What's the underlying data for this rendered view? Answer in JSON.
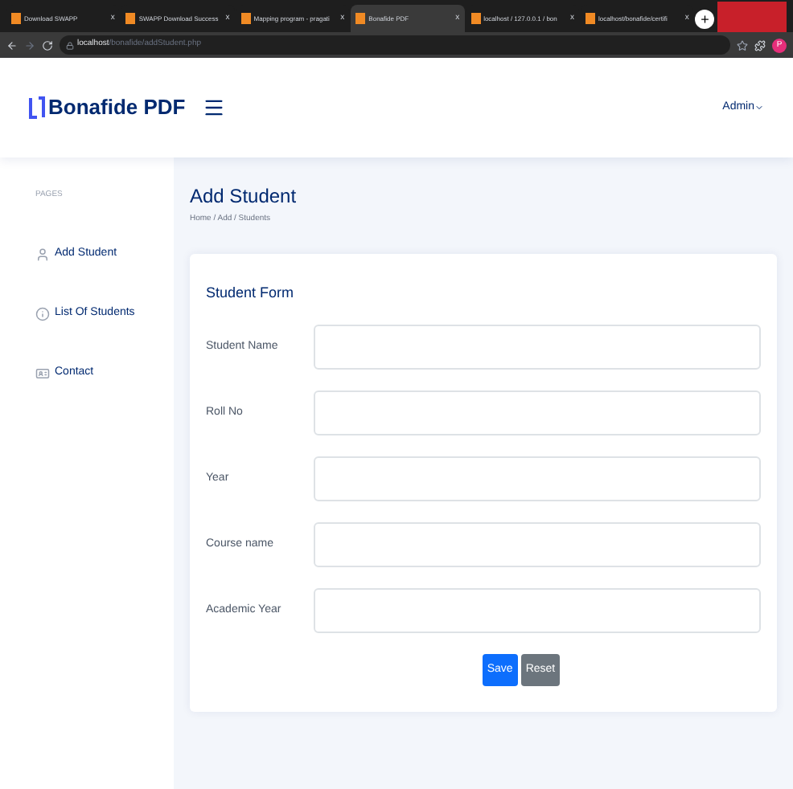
{
  "browser": {
    "tabs": [
      {
        "title": "Download SWAPP",
        "close": "x",
        "selected": false
      },
      {
        "title": "SWAPP Download Success",
        "close": "x",
        "selected": false
      },
      {
        "title": "Mapping program - pragati",
        "close": "x",
        "selected": false
      },
      {
        "title": "Bonafide PDF",
        "close": "x",
        "selected": true
      },
      {
        "title": "localhost / 127.0.0.1 / bon",
        "close": "x",
        "selected": false
      },
      {
        "title": "localhost/bonafide/certifi",
        "close": "x",
        "selected": false
      }
    ],
    "new_tab": "+",
    "url_host": "localhost",
    "url_path": "/bonafide/addStudent.php",
    "profile": "P"
  },
  "header": {
    "logo": "Bonafide PDF",
    "user": "Admin"
  },
  "sidebar": {
    "section": "PAGES",
    "items": [
      {
        "label": "Add Student",
        "kind": "person"
      },
      {
        "label": "List Of Students",
        "kind": "info"
      },
      {
        "label": "Contact",
        "kind": "card"
      }
    ]
  },
  "page": {
    "title": "Add Student",
    "breadcrumb": "Home / Add / Students"
  },
  "form": {
    "title": "Student Form",
    "fields": [
      {
        "label": "Student Name"
      },
      {
        "label": "Roll No"
      },
      {
        "label": "Year"
      },
      {
        "label": "Course name"
      },
      {
        "label": "Academic Year"
      }
    ],
    "buttons": [
      {
        "label": "Save",
        "kind": "primary"
      },
      {
        "label": "Reset",
        "kind": "secondary"
      }
    ]
  }
}
